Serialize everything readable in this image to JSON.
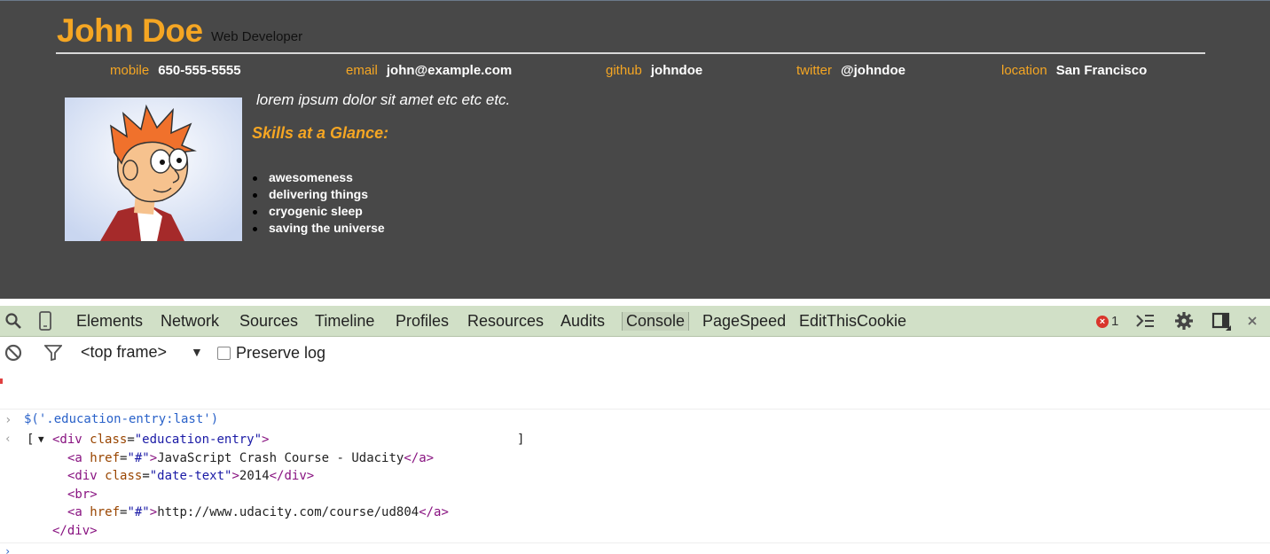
{
  "resume": {
    "name": "John Doe",
    "role": "Web Developer",
    "contacts": [
      {
        "label": "mobile",
        "value": "650-555-5555"
      },
      {
        "label": "email",
        "value": "john@example.com"
      },
      {
        "label": "github",
        "value": "johndoe"
      },
      {
        "label": "twitter",
        "value": "@johndoe"
      },
      {
        "label": "location",
        "value": "San Francisco"
      }
    ],
    "welcome": "lorem ipsum dolor sit amet etc etc etc.",
    "skills_heading": "Skills at a Glance:",
    "skills": [
      "awesomeness",
      "delivering things",
      "cryogenic sleep",
      "saving the universe"
    ]
  },
  "devtools": {
    "tabs": [
      "Elements",
      "Network",
      "Sources",
      "Timeline",
      "Profiles",
      "Resources",
      "Audits",
      "Console",
      "PageSpeed",
      "EditThisCookie"
    ],
    "active_tab": "Console",
    "error_count": "1",
    "toolbar": {
      "frame": "<top frame>",
      "preserve_log": "Preserve log"
    },
    "console": {
      "command": "$('.education-entry:last')",
      "open_bracket": "[",
      "close_bracket": "]",
      "div_open_tag": "<div",
      "div_class_attr": "class",
      "div_class_val": "\"education-entry\"",
      "gt": ">",
      "link1_text": "JavaScript Crash Course - Udacity",
      "date_class_val": "\"date-text\"",
      "date_text": "2014",
      "br": "<br>",
      "link2_text": "http://www.udacity.com/course/ud804",
      "close_div": "</div>",
      "href_attr": "href",
      "href_val": "\"#\"",
      "a_open": "<a",
      "a_close": "</a>",
      "div_tag_open": "<div",
      "div_tag_close": "</div>"
    }
  },
  "colors": {
    "accent": "#f5a623",
    "page_bg": "#484848",
    "devtools_tab_bg": "#d1e0c7",
    "tag": "#881280",
    "attr": "#994500",
    "value": "#1a1aa6",
    "error": "#d9352b"
  }
}
